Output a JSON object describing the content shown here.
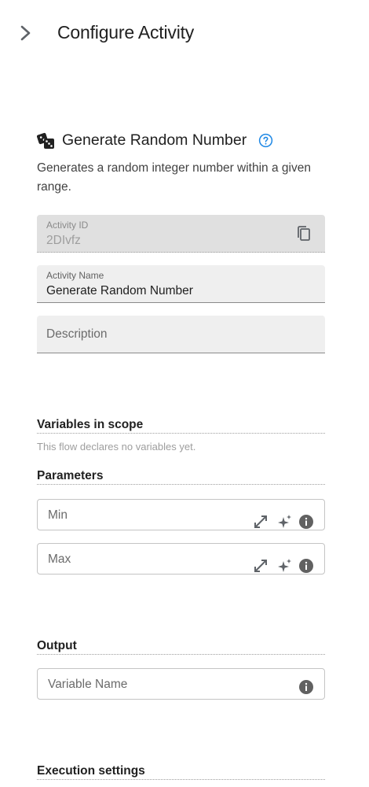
{
  "header": {
    "title": "Configure Activity",
    "collapse_icon": "chevron-right-icon"
  },
  "activity": {
    "icon": "dice-icon",
    "title": "Generate Random Number",
    "help_icon": "help-circle-icon",
    "description": "Generates a random integer number within a given range."
  },
  "fields": {
    "activity_id": {
      "label": "Activity ID",
      "value": "2DIvfz",
      "action_icon": "copy-icon"
    },
    "activity_name": {
      "label": "Activity Name",
      "value": "Generate Random Number"
    },
    "description": {
      "placeholder": "Description"
    }
  },
  "variables": {
    "title": "Variables in scope",
    "hint": "This flow declares no variables yet."
  },
  "parameters": {
    "title": "Parameters",
    "items": [
      {
        "placeholder": "Min",
        "icons": [
          "expand-icon",
          "sparkle-icon",
          "info-icon"
        ]
      },
      {
        "placeholder": "Max",
        "icons": [
          "expand-icon",
          "sparkle-icon",
          "info-icon"
        ]
      }
    ]
  },
  "output": {
    "title": "Output",
    "placeholder": "Variable Name",
    "icon": "info-icon"
  },
  "execution": {
    "title": "Execution settings"
  },
  "colors": {
    "accent": "#1e88e5",
    "icon": "#5f6368"
  }
}
